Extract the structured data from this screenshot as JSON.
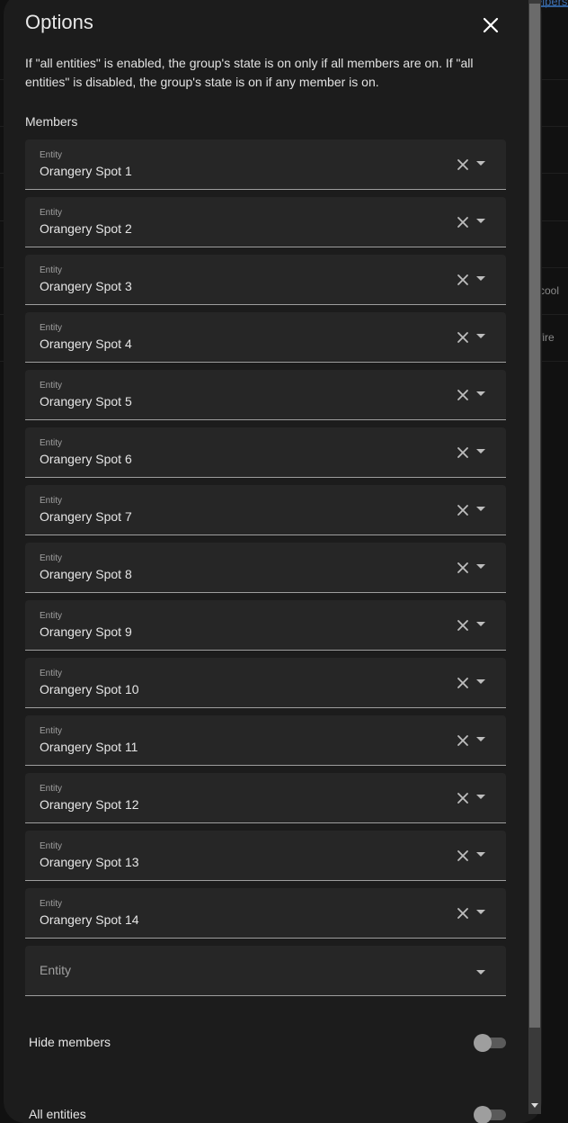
{
  "background": {
    "tab_partial": "elpers",
    "row_texts": [
      "cool",
      "fire"
    ]
  },
  "dialog": {
    "title": "Options",
    "close_icon": "close-icon",
    "description": "If \"all entities\" is enabled, the group's state is on only if all members are on. If \"all entities\" is disabled, the group's state is on if any member is on.",
    "members_label": "Members",
    "entity_label": "Entity",
    "members": [
      "Orangery Spot 1",
      "Orangery Spot 2",
      "Orangery Spot 3",
      "Orangery Spot 4",
      "Orangery Spot 5",
      "Orangery Spot 6",
      "Orangery Spot 7",
      "Orangery Spot 8",
      "Orangery Spot 9",
      "Orangery Spot 10",
      "Orangery Spot 11",
      "Orangery Spot 12",
      "Orangery Spot 13",
      "Orangery Spot 14"
    ],
    "empty_entity_placeholder": "Entity",
    "hide_members_label": "Hide members",
    "hide_members_value": false,
    "all_entities_label": "All entities",
    "all_entities_value": false
  },
  "colors": {
    "dialog_bg": "#1c1c1c",
    "field_bg": "#262626",
    "accent": "#3f6fae"
  }
}
